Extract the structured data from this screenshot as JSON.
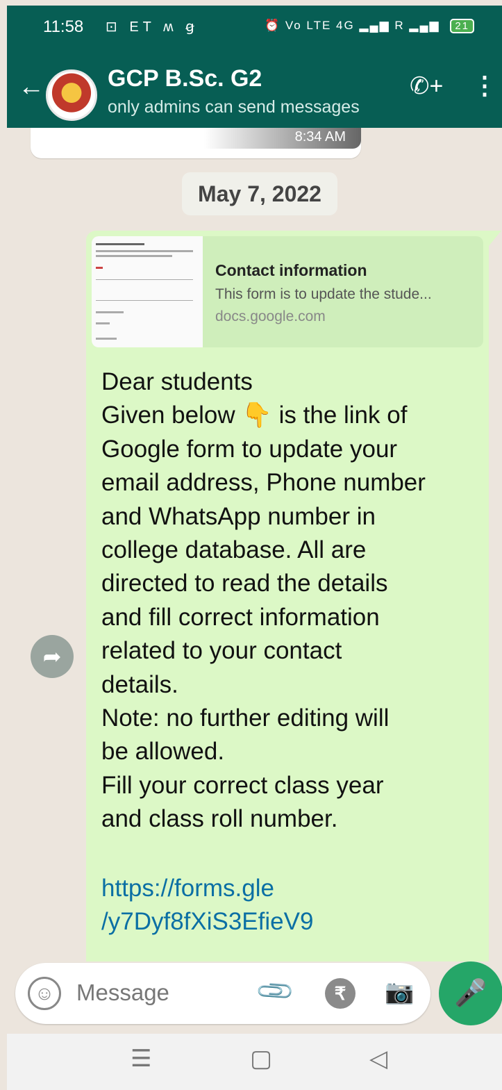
{
  "status_bar": {
    "time": "11:58",
    "left_icons": "⊡ ET ʍ ꞡ",
    "right_icons": "⏰ Vo LTE 4G ▂▄▆ R ▂▄▆",
    "battery": "21"
  },
  "header": {
    "back_icon": "←",
    "group_name": "GCP B.Sc. G2",
    "subtitle": "only admins can send messages",
    "call_icon": "✆+",
    "more_icon": "⋮"
  },
  "chat": {
    "previous_message_time": "8:34 AM",
    "date_chip": "May 7, 2022",
    "message": {
      "link_preview": {
        "title": "Contact information",
        "description": "This form is to update the stude...",
        "domain": "docs.google.com"
      },
      "text": "Dear students\nGiven below 👇 is the link of\nGoogle form to update your\nemail address, Phone number\nand WhatsApp number in\ncollege database. All are\ndirected to read the details\nand fill correct information\nrelated to your contact\ndetails.\nNote: no further editing will\nbe allowed.\nFill your correct class year\nand class  roll number.",
      "link_line1": "https://forms.gle",
      "link_line2": "/y7Dyf8fXiS3EfieV9"
    },
    "forward_icon": "➦",
    "scroll_down_icon": "»"
  },
  "composer": {
    "emoji_icon": "☺",
    "placeholder": "Message",
    "attach_icon": "📎",
    "rupee_icon": "₹",
    "camera_icon": "📷",
    "mic_icon": "🎤"
  },
  "nav": {
    "menu_icon": "☰",
    "home_icon": "▢",
    "back_icon": "◁"
  }
}
